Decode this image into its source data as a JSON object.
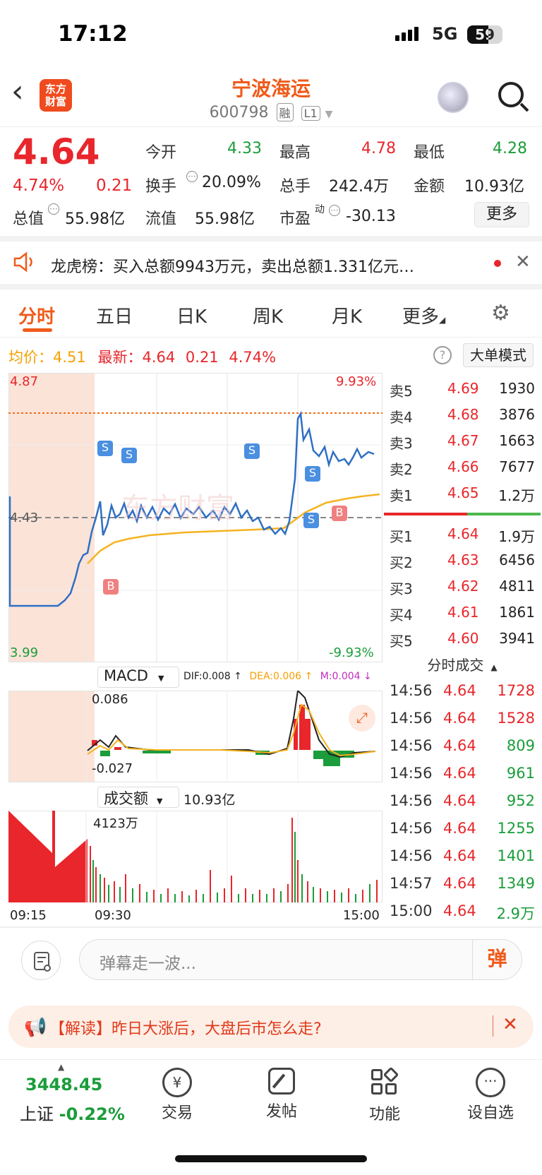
{
  "status": {
    "time": "17:12",
    "network": "5G",
    "battery": "59"
  },
  "header": {
    "logo_line1": "东方",
    "logo_line2": "财富",
    "name": "宁波海运",
    "code": "600798",
    "tag1": "融",
    "tag2": "L1"
  },
  "quote": {
    "price": "4.64",
    "change_pct": "4.74%",
    "change_amt": "0.21",
    "open_label": "今开",
    "open": "4.33",
    "high_label": "最高",
    "high": "4.78",
    "low_label": "最低",
    "low": "4.28",
    "turnover_label": "换手",
    "turnover": "20.09%",
    "volume_label": "总手",
    "volume": "242.4万",
    "amount_label": "金额",
    "amount": "10.93亿",
    "mcap_label": "总值",
    "mcap": "55.98亿",
    "float_label": "流值",
    "float_cap": "55.98亿",
    "pe_label": "市盈",
    "pe_sup": "动",
    "pe": "-30.13",
    "more": "更多"
  },
  "notice": {
    "text": "龙虎榜：买入总额9943万元，卖出总额1.331亿元…"
  },
  "tabs": [
    "分时",
    "五日",
    "日K",
    "周K",
    "月K",
    "更多"
  ],
  "info": {
    "avg_label": "均价：",
    "avg": "4.51",
    "latest_label": "最新：",
    "latest": "4.64",
    "chg": "0.21",
    "pct": "4.74%",
    "mode_btn": "大单模式",
    "help": "?"
  },
  "chart_labels": {
    "top_price": "4.87",
    "top_pct": "9.93%",
    "mid_price": "4.43",
    "bottom_price": "3.99",
    "bottom_pct": "-9.93%",
    "watermark": "东方财富"
  },
  "macd": {
    "label": "MACD",
    "dif": "DIF:0.008",
    "dea": "DEA:0.006",
    "m": "M:0.004",
    "max": "0.086",
    "min": "-0.027"
  },
  "volpanel": {
    "label": "成交额",
    "total": "10.93亿",
    "max": "4123万",
    "t1": "09:15",
    "t2": "09:30",
    "t3": "15:00"
  },
  "orderbook": {
    "sell": [
      {
        "name": "卖5",
        "price": "4.69",
        "vol": "1930"
      },
      {
        "name": "卖4",
        "price": "4.68",
        "vol": "3876"
      },
      {
        "name": "卖3",
        "price": "4.67",
        "vol": "1663"
      },
      {
        "name": "卖2",
        "price": "4.66",
        "vol": "7677"
      },
      {
        "name": "卖1",
        "price": "4.65",
        "vol": "1.2万"
      }
    ],
    "buy": [
      {
        "name": "买1",
        "price": "4.64",
        "vol": "1.9万"
      },
      {
        "name": "买2",
        "price": "4.63",
        "vol": "6456"
      },
      {
        "name": "买3",
        "price": "4.62",
        "vol": "4811"
      },
      {
        "name": "买4",
        "price": "4.61",
        "vol": "1861"
      },
      {
        "name": "买5",
        "price": "4.60",
        "vol": "3941"
      }
    ]
  },
  "trades": {
    "title": "分时成交",
    "rows": [
      {
        "time": "14:56",
        "price": "4.64",
        "vol": "1728",
        "dir": "red"
      },
      {
        "time": "14:56",
        "price": "4.64",
        "vol": "1528",
        "dir": "red"
      },
      {
        "time": "14:56",
        "price": "4.64",
        "vol": "809",
        "dir": "green"
      },
      {
        "time": "14:56",
        "price": "4.64",
        "vol": "961",
        "dir": "green"
      },
      {
        "time": "14:56",
        "price": "4.64",
        "vol": "952",
        "dir": "green"
      },
      {
        "time": "14:56",
        "price": "4.64",
        "vol": "1255",
        "dir": "green"
      },
      {
        "time": "14:56",
        "price": "4.64",
        "vol": "1401",
        "dir": "green"
      },
      {
        "time": "14:57",
        "price": "4.64",
        "vol": "1349",
        "dir": "green"
      },
      {
        "time": "15:00",
        "price": "4.64",
        "vol": "2.9万",
        "dir": "green"
      }
    ]
  },
  "barrage": {
    "placeholder": "弹幕走一波...",
    "btn": "弹"
  },
  "news": {
    "text": "【解读】昨日大涨后，大盘后市怎么走?"
  },
  "nav": {
    "index_value": "3448.45",
    "index_name": "上证",
    "index_pct": "-0.22%",
    "items": [
      "交易",
      "发帖",
      "功能",
      "设自选"
    ]
  },
  "colors": {
    "up": "#e8262b",
    "down": "#1a9d3a",
    "accent": "#f05a1a",
    "price_line": "#2f6fc4",
    "avg_line": "#f5b321"
  }
}
